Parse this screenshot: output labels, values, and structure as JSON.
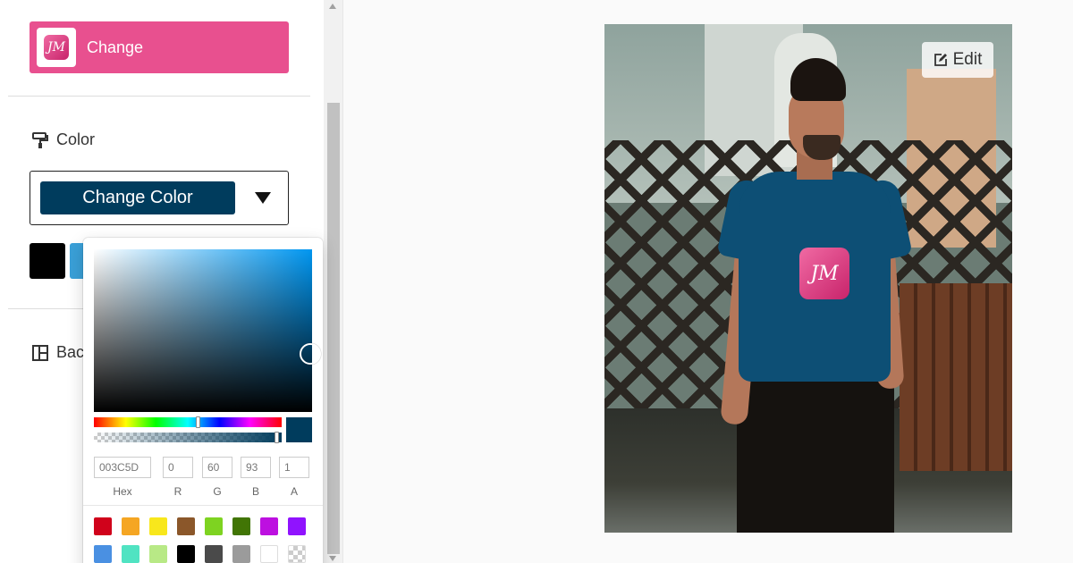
{
  "sidebar": {
    "logo_button": {
      "label": "Change",
      "logo_text": "JM"
    },
    "color_section": {
      "title": "Color",
      "dropdown_label": "Change Color",
      "current_color": "#003c5d"
    },
    "swatches": [
      "#000000",
      "#3aa0d8"
    ],
    "background_section": {
      "title": "Bac"
    }
  },
  "color_picker": {
    "hue_color": "#0096f0",
    "hex": {
      "value": "003C5D",
      "label": "Hex"
    },
    "r": {
      "value": "0",
      "label": "R"
    },
    "g": {
      "value": "60",
      "label": "G"
    },
    "b": {
      "value": "93",
      "label": "B"
    },
    "a": {
      "value": "1",
      "label": "A"
    },
    "presets": [
      "#d0021b",
      "#f5a623",
      "#f8e71c",
      "#8b572a",
      "#7ed321",
      "#417505",
      "#bd10e0",
      "#9013fe",
      "#4a90e2",
      "#50e3c2",
      "#b8e986",
      "#000000",
      "#4a4a4a",
      "#9b9b9b",
      "#ffffff",
      "transparent"
    ]
  },
  "preview": {
    "edit_label": "Edit",
    "shirt_color": "#0d4f75",
    "logo_text": "JM"
  }
}
